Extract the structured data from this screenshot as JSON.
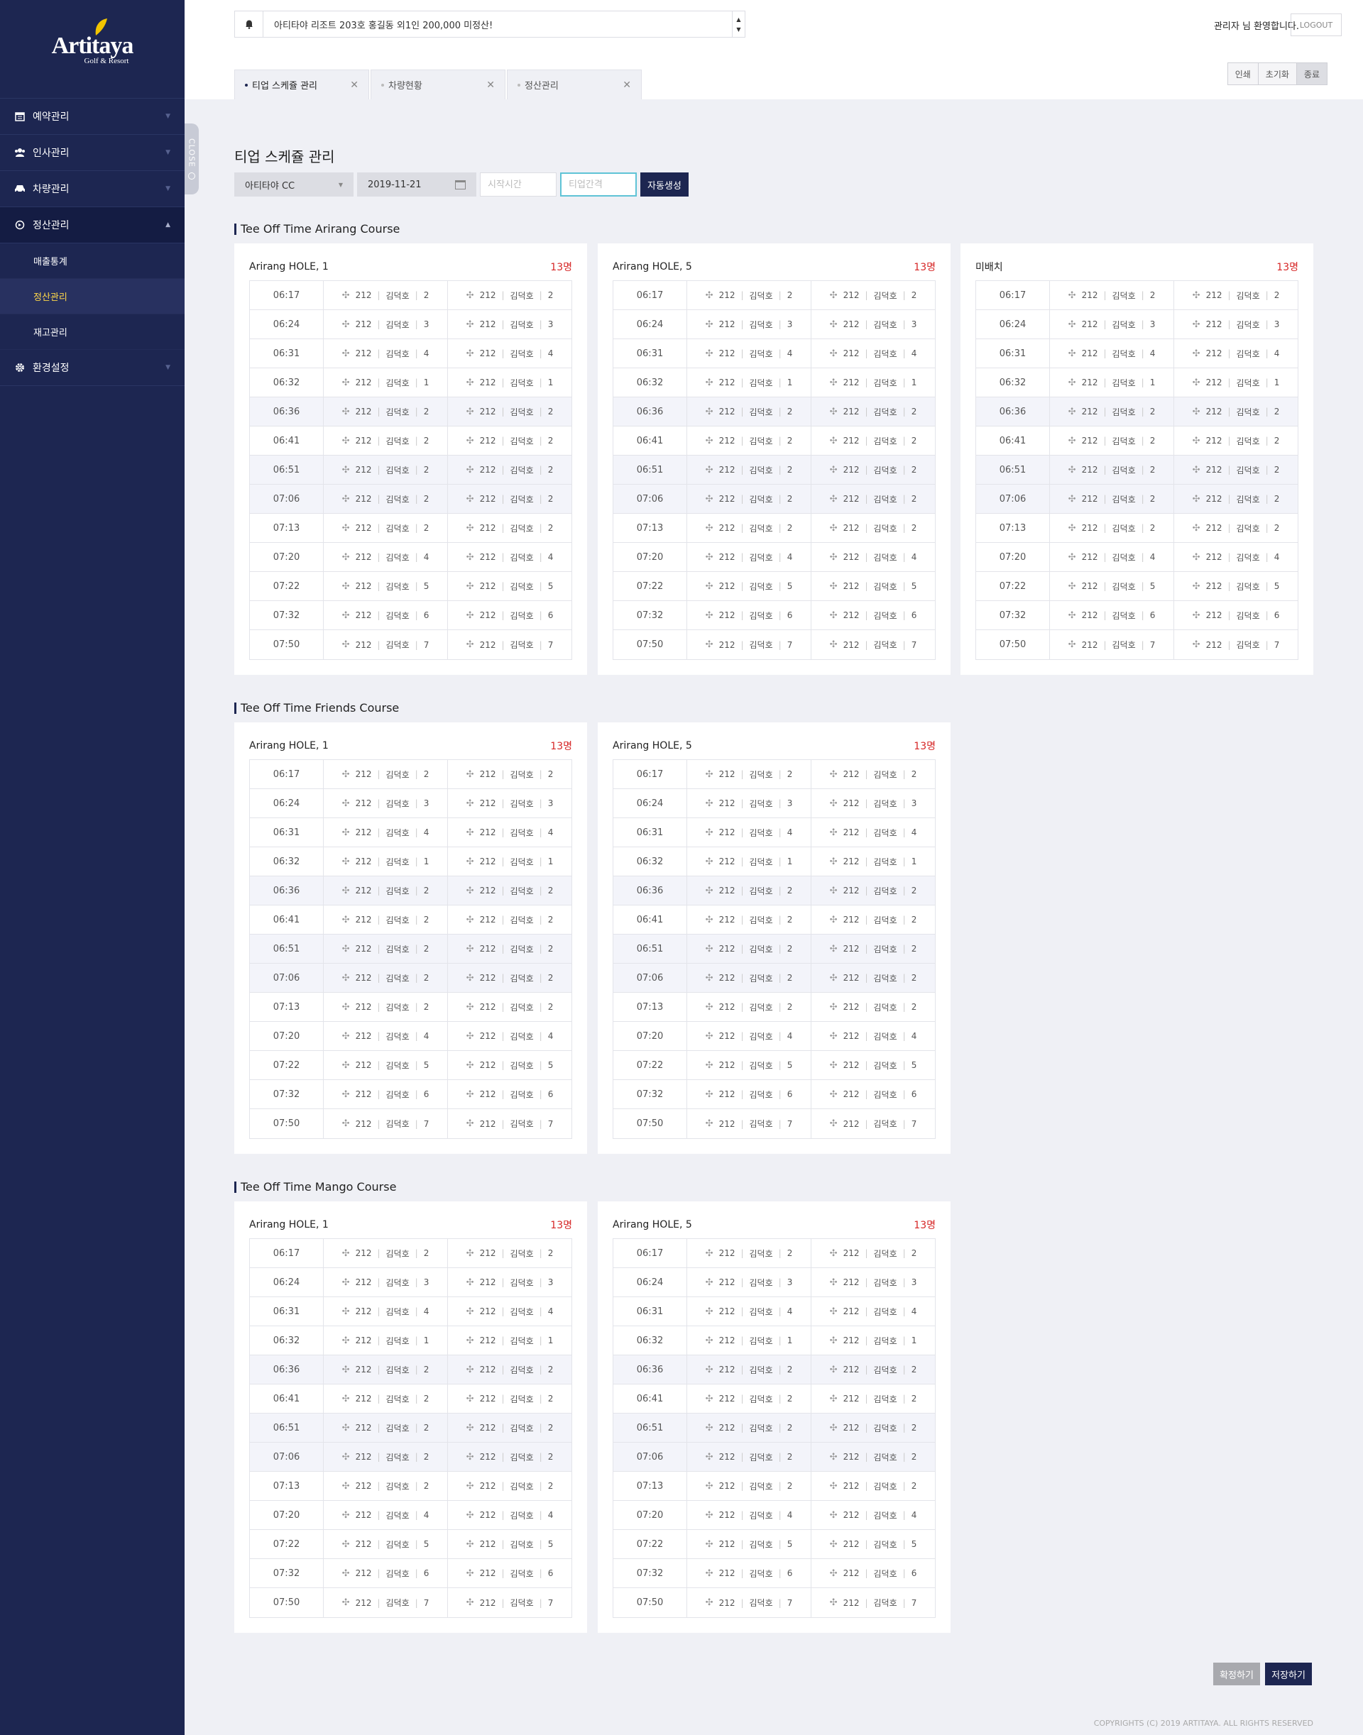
{
  "sidebar": {
    "brand": "Artitaya",
    "brand_sub": "Golf & Resort",
    "menu": [
      {
        "label": "예약관리",
        "icon": "calendar-icon"
      },
      {
        "label": "인사관리",
        "icon": "users-icon"
      },
      {
        "label": "차량관리",
        "icon": "car-icon"
      },
      {
        "label": "정산관리",
        "icon": "refresh-icon",
        "open": true
      },
      {
        "label": "환경설정",
        "icon": "gear-icon"
      }
    ],
    "submenu": [
      {
        "label": "매출통계"
      },
      {
        "label": "정산관리",
        "active": true
      },
      {
        "label": "재고관리"
      }
    ],
    "close_label": "CLOSE"
  },
  "header": {
    "notice": "아티타야 리조트 203호 홍길동 외1인 200,000 미정산!",
    "welcome": "관리자 님 환영합니다.",
    "logout": "LOGOUT",
    "tabs": [
      {
        "label": "티업 스케쥴 관리",
        "active": true
      },
      {
        "label": "차량현황"
      },
      {
        "label": "정산관리"
      }
    ],
    "actions": [
      "인쇄",
      "초기화",
      "종료"
    ]
  },
  "page": {
    "title": "티업 스케쥴 관리",
    "filters": {
      "club": "아티타야 CC",
      "date": "2019-11-21",
      "start_placeholder": "시작시간",
      "interval_placeholder": "티업간격",
      "generate": "자동생성"
    }
  },
  "rows": [
    {
      "time": "06:17",
      "num": "212",
      "name": "김덕호",
      "qty": "2"
    },
    {
      "time": "06:24",
      "num": "212",
      "name": "김덕호",
      "qty": "3"
    },
    {
      "time": "06:31",
      "num": "212",
      "name": "김덕호",
      "qty": "4"
    },
    {
      "time": "06:32",
      "num": "212",
      "name": "김덕호",
      "qty": "1"
    },
    {
      "time": "06:36",
      "num": "212",
      "name": "김덕호",
      "qty": "2",
      "alt": true
    },
    {
      "time": "06:41",
      "num": "212",
      "name": "김덕호",
      "qty": "2"
    },
    {
      "time": "06:51",
      "num": "212",
      "name": "김덕호",
      "qty": "2",
      "alt": true
    },
    {
      "time": "07:06",
      "num": "212",
      "name": "김덕호",
      "qty": "2",
      "alt": true
    },
    {
      "time": "07:13",
      "num": "212",
      "name": "김덕호",
      "qty": "2"
    },
    {
      "time": "07:20",
      "num": "212",
      "name": "김덕호",
      "qty": "4"
    },
    {
      "time": "07:22",
      "num": "212",
      "name": "김덕호",
      "qty": "5"
    },
    {
      "time": "07:32",
      "num": "212",
      "name": "김덕호",
      "qty": "6"
    },
    {
      "time": "07:50",
      "num": "212",
      "name": "김덕호",
      "qty": "7"
    }
  ],
  "sections": [
    {
      "title": "Tee Off Time Arirang Course",
      "cards": [
        {
          "name": "Arirang HOLE, 1",
          "count": "13명"
        },
        {
          "name": "Arirang HOLE, 5",
          "count": "13명"
        },
        {
          "name": "미배치",
          "count": "13명"
        }
      ]
    },
    {
      "title": "Tee Off Time Friends Course",
      "cards": [
        {
          "name": "Arirang HOLE, 1",
          "count": "13명"
        },
        {
          "name": "Arirang HOLE, 5",
          "count": "13명"
        }
      ]
    },
    {
      "title": "Tee Off Time Mango Course",
      "cards": [
        {
          "name": "Arirang HOLE, 1",
          "count": "13명"
        },
        {
          "name": "Arirang HOLE, 5",
          "count": "13명"
        }
      ]
    }
  ],
  "footer": {
    "confirm": "확정하기",
    "save": "저장하기",
    "copyright": "COPYRIGHTS (C) 2019 ARTITAYA. ALL RIGHTS RESERVED"
  }
}
